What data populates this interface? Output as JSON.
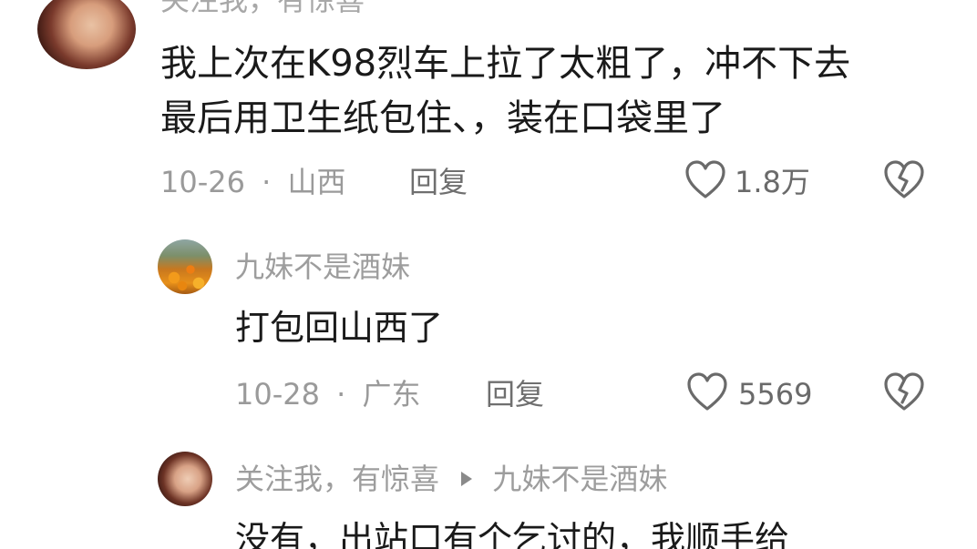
{
  "comments": [
    {
      "author": "关注我，有惊喜",
      "text_line1": "我上次在K98烈车上拉了太粗了，冲不下去",
      "text_line2": "最后用卫生纸包住、，装在口袋里了",
      "date": "10-26",
      "location": "山西",
      "reply_label": "回复",
      "likes": "1.8万"
    },
    {
      "author": "九妹不是酒妹",
      "text": "打包回山西了",
      "date": "10-28",
      "location": "广东",
      "reply_label": "回复",
      "likes": "5569"
    },
    {
      "author": "关注我，有惊喜",
      "reply_to": "九妹不是酒妹",
      "text": "没有，出站口有个乞讨的，我顺手给"
    }
  ],
  "separator": "·",
  "icons": {
    "like": "heart-outline-icon",
    "dislike": "broken-heart-icon",
    "reply_arrow": "triangle-right-icon"
  },
  "colors": {
    "text_primary": "#1a1a1a",
    "text_secondary": "#9a9a9a",
    "icon": "#6a6a6a"
  }
}
